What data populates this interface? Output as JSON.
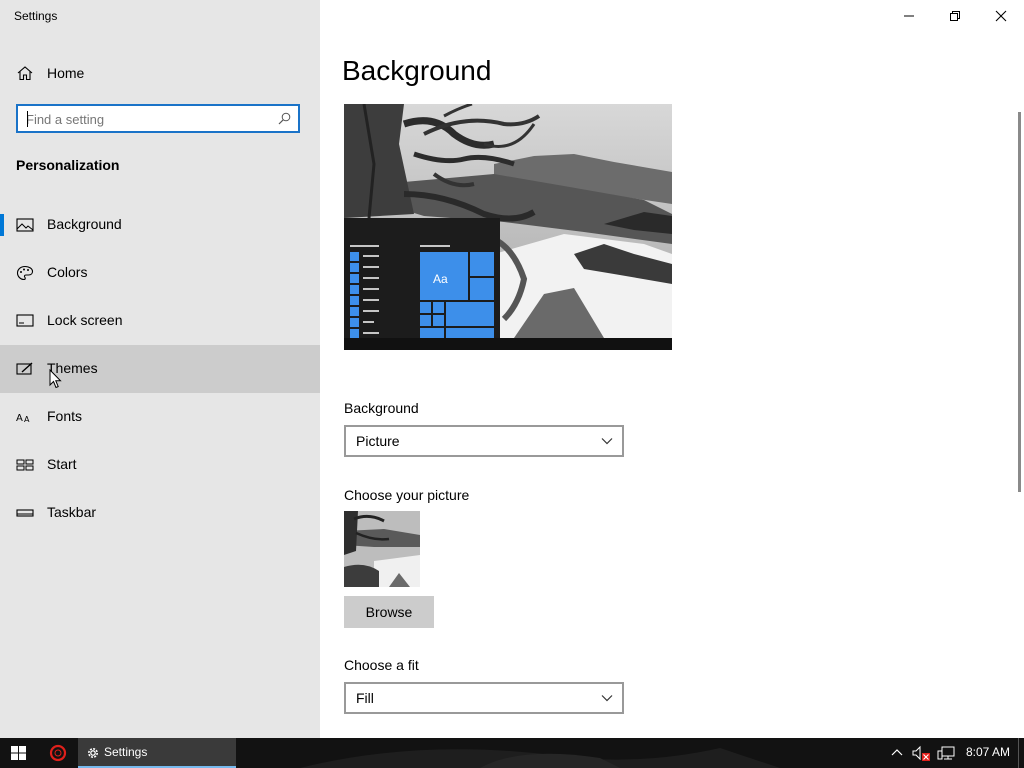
{
  "window": {
    "title": "Settings",
    "controls": {
      "minimize": "minimize-icon",
      "maximize": "restore-icon",
      "close": "close-icon"
    }
  },
  "sidebar": {
    "home_label": "Home",
    "search_placeholder": "Find a setting",
    "section_title": "Personalization",
    "items": [
      {
        "label": "Background",
        "icon": "picture-icon",
        "selected": true
      },
      {
        "label": "Colors",
        "icon": "palette-icon"
      },
      {
        "label": "Lock screen",
        "icon": "lock-screen-icon"
      },
      {
        "label": "Themes",
        "icon": "themes-icon",
        "hovered": true
      },
      {
        "label": "Fonts",
        "icon": "fonts-icon"
      },
      {
        "label": "Start",
        "icon": "start-icon"
      },
      {
        "label": "Taskbar",
        "icon": "taskbar-icon"
      }
    ]
  },
  "main": {
    "title": "Background",
    "preview_tile_text": "Aa",
    "background_label": "Background",
    "background_value": "Picture",
    "choose_picture_label": "Choose your picture",
    "browse_label": "Browse",
    "fit_label": "Choose a fit",
    "fit_value": "Fill"
  },
  "taskbar": {
    "app_label": "Settings",
    "clock": "8:07 AM"
  },
  "colors": {
    "accent": "#0078d7",
    "tile_blue": "#3d8fea",
    "sidebar_bg": "#e6e6e6",
    "hover_bg": "#cccccc",
    "taskbar_bg": "#101010"
  }
}
